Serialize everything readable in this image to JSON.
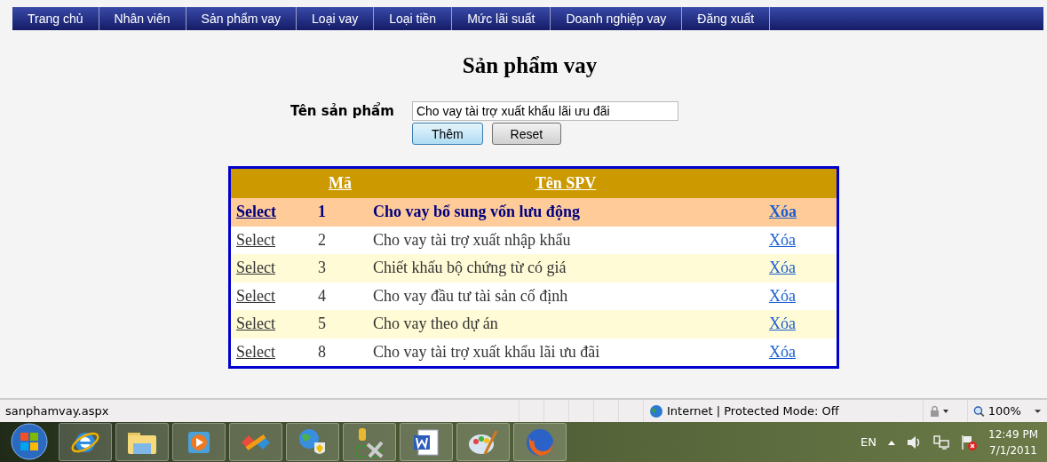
{
  "menu": [
    "Trang chủ",
    "Nhân viên",
    "Sản phẩm vay",
    "Loại vay",
    "Loại tiền",
    "Mức lãi suất",
    "Doanh nghiệp vay",
    "Đăng xuất"
  ],
  "title": "Sản phẩm vay",
  "form": {
    "label": "Tên sản phẩm",
    "value": "Cho vay tài trợ xuất khẩu lãi ưu đãi",
    "buttons": [
      {
        "label": "Thêm",
        "focused": true
      },
      {
        "label": "Reset",
        "focused": false
      }
    ]
  },
  "table": {
    "columns": [
      "Mã",
      "Tên SPV"
    ],
    "rows": [
      {
        "select": "Select",
        "code": "1",
        "name": "Cho vay bổ sung vốn lưu động",
        "delete": "Xóa",
        "selected": true
      },
      {
        "select": "Select",
        "code": "2",
        "name": "Cho vay tài trợ xuất nhập khẩu",
        "delete": "Xóa",
        "selected": false
      },
      {
        "select": "Select",
        "code": "3",
        "name": "Chiết khấu bộ chứng từ có giá",
        "delete": "Xóa",
        "selected": false
      },
      {
        "select": "Select",
        "code": "4",
        "name": "Cho vay đầu tư tài sản cố định",
        "delete": "Xóa",
        "selected": false
      },
      {
        "select": "Select",
        "code": "5",
        "name": "Cho vay theo dự án",
        "delete": "Xóa",
        "selected": false
      },
      {
        "select": "Select",
        "code": "8",
        "name": "Cho vay tài trợ xuất khẩu lãi ưu đãi",
        "delete": "Xóa",
        "selected": false
      }
    ]
  },
  "status_bar": {
    "url": "sanphamvay.aspx",
    "zone": "Internet | Protected Mode: Off",
    "zoom": "100%"
  },
  "taskbar": {
    "apps": [
      {
        "kind": "browser"
      },
      {
        "kind": "folder"
      },
      {
        "kind": "player"
      },
      {
        "kind": "studio"
      },
      {
        "kind": "globe"
      },
      {
        "kind": "tools"
      },
      {
        "kind": "word"
      },
      {
        "kind": "paint"
      },
      {
        "kind": "firefox"
      }
    ],
    "language": "EN",
    "time": "12:49 PM",
    "date": "7/1/2011"
  }
}
